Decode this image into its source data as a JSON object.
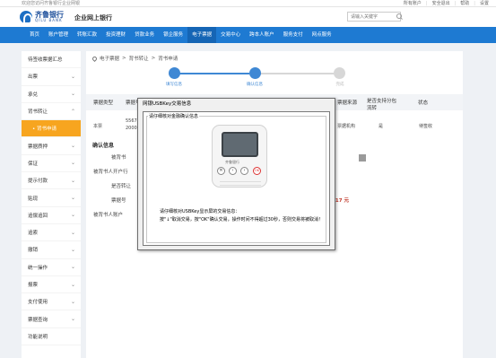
{
  "topbar": {
    "welcome": "欢迎您访问齐鲁银行企业网银",
    "links": [
      "所有账户",
      "|",
      "安全退出",
      "|",
      "帮助",
      "|",
      "设置"
    ]
  },
  "header": {
    "brand_cn": "齐鲁银行",
    "brand_en": "QILU BANK",
    "subtitle": "企业网上银行",
    "search_placeholder": "请输入关键字"
  },
  "nav": {
    "items": [
      {
        "label": "首页",
        "active": false
      },
      {
        "label": "账户管理",
        "active": false
      },
      {
        "label": "转账汇款",
        "active": false
      },
      {
        "label": "投资理财",
        "active": false
      },
      {
        "label": "贷款业务",
        "active": false
      },
      {
        "label": "银企服务",
        "active": false
      },
      {
        "label": "电子票据",
        "active": true
      },
      {
        "label": "交易中心",
        "active": false
      },
      {
        "label": "跨本人账户",
        "active": false
      },
      {
        "label": "服务支付",
        "active": false
      },
      {
        "label": "网点服务",
        "active": false
      }
    ]
  },
  "sidebar": {
    "items": [
      {
        "label": "待签收票据汇总",
        "chev": "",
        "active": false
      },
      {
        "label": "出票",
        "chev": "⌄",
        "active": false
      },
      {
        "label": "承兑",
        "chev": "⌄",
        "active": false
      },
      {
        "label": "背书转让",
        "chev": "⌃",
        "active": false
      },
      {
        "label": "• 背书申请",
        "chev": "",
        "active": true
      },
      {
        "label": "票据质押",
        "chev": "⌄",
        "active": false
      },
      {
        "label": "保证",
        "chev": "⌄",
        "active": false
      },
      {
        "label": "提示付款",
        "chev": "⌄",
        "active": false
      },
      {
        "label": "贴现",
        "chev": "⌄",
        "active": false
      },
      {
        "label": "追偿追回",
        "chev": "⌄",
        "active": false
      },
      {
        "label": "追索",
        "chev": "⌄",
        "active": false
      },
      {
        "label": "撤销",
        "chev": "⌄",
        "active": false
      },
      {
        "label": "统一操作",
        "chev": "⌄",
        "active": false
      },
      {
        "label": "报票",
        "chev": "⌄",
        "active": false
      },
      {
        "label": "支付使用",
        "chev": "⌄",
        "active": false
      },
      {
        "label": "票据查询",
        "chev": "⌄",
        "active": false
      },
      {
        "label": "功能说明",
        "chev": "",
        "active": false
      }
    ]
  },
  "breadcrumb": [
    "电子票据",
    ">",
    "背书转让",
    ">",
    "背书申请"
  ],
  "steps": [
    {
      "label": "填写信息",
      "active": true
    },
    {
      "label": "确认信息",
      "active": true
    },
    {
      "label": "完成",
      "active": false
    }
  ],
  "table": {
    "headers": [
      "票据类型",
      "票据号码",
      "票据来源",
      "是否支持分包流转",
      "状态"
    ],
    "row": [
      "本票",
      "5567 ...",
      "2000 ...",
      "票据机构",
      "是",
      "待签收"
    ]
  },
  "confirm": {
    "title": "确认信息",
    "labels": [
      "被背书",
      "被背书人开户行",
      "是否转让",
      "票据号",
      "被背书人账户"
    ],
    "amount_suffix": "是",
    "amount": "0.17 元"
  },
  "dialog": {
    "title": "网银USBKey交易信息",
    "group_label": "请仔细核对金融确认信息",
    "device_brand": "齐鲁银行",
    "buttons": [
      "✕",
      "‹",
      "›",
      "OK"
    ],
    "line1": "请仔细核对USBKey显示屏的交易信息：",
    "line2": "按\"↓\"取消交易，按\"OK\"确认交易，操作时间不得超过30秒，否则交易将被取消！"
  }
}
